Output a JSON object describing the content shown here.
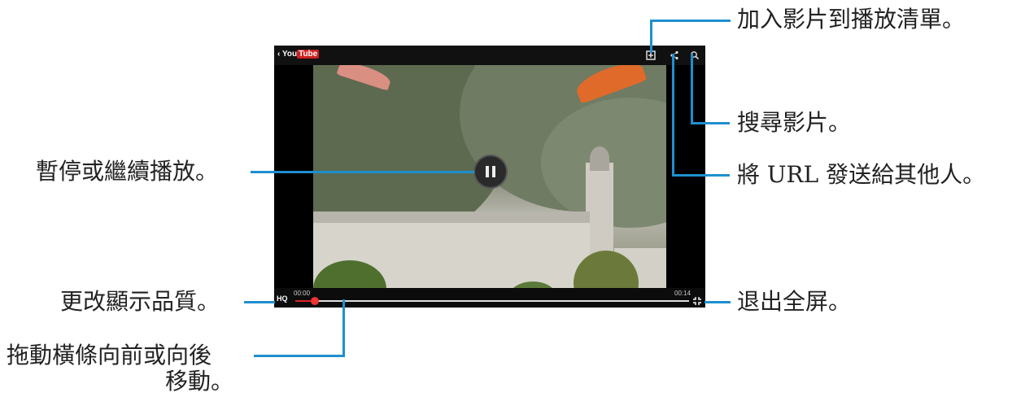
{
  "player": {
    "logo_prefix": "‹ You",
    "logo_tube": "Tube",
    "time_start": "00:00",
    "time_end": "00:14",
    "quality_label": "HQ",
    "progress_fraction": 0.05,
    "icons": {
      "playlist": "playlist-add-icon",
      "share": "share-icon",
      "search": "search-icon",
      "pause": "pause-icon",
      "exit_fullscreen": "exit-fullscreen-icon"
    },
    "colors": {
      "accent": "#1e8fcf",
      "progress": "#dd2222",
      "brand": "#cc1f1f"
    }
  },
  "callouts": {
    "add_playlist": "加入影片到播放清單。",
    "search": "搜尋影片。",
    "pause_resume": "暫停或繼續播放。",
    "share_url": "將 URL 發送給其他人。",
    "quality": "更改顯示品質。",
    "exit_fullscreen": "退出全屏。",
    "drag_line1": "拖動橫條向前或向後",
    "drag_line2": "移動。"
  }
}
